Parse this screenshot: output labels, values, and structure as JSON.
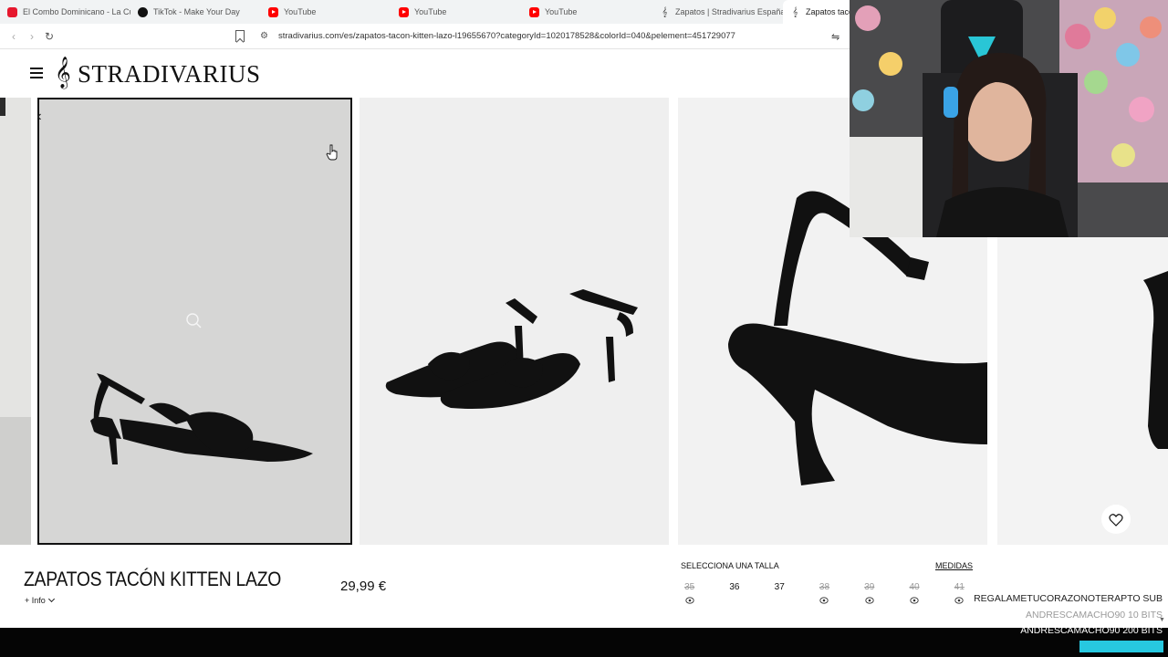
{
  "browser": {
    "tabs": [
      {
        "label": "El Combo Dominicano - La Cu",
        "favicon": "red-app-icon",
        "active": false
      },
      {
        "label": "TikTok - Make Your Day",
        "favicon": "tiktok-icon",
        "active": false
      },
      {
        "label": "YouTube",
        "favicon": "youtube-icon",
        "active": false
      },
      {
        "label": "YouTube",
        "favicon": "youtube-icon",
        "active": false
      },
      {
        "label": "YouTube",
        "favicon": "youtube-icon",
        "active": false
      },
      {
        "label": "Zapatos | Stradivarius España",
        "favicon": "stradivarius-icon",
        "active": false
      },
      {
        "label": "Zapatos tacón",
        "favicon": "stradivarius-icon",
        "active": true
      }
    ],
    "url": "stradivarius.com/es/zapatos-tacon-kitten-lazo-l19655670?categoryId=1020178528&colorId=040&pelement=451729077",
    "icons": {
      "back": "back-arrow-icon",
      "forward": "forward-arrow-icon",
      "reload": "reload-icon",
      "bookmark": "bookmark-icon",
      "site_info": "site-info-icon",
      "extension": "extension-icon"
    }
  },
  "site": {
    "logo_text": "STRADIVARIUS",
    "menu_icon": "hamburger-menu-icon"
  },
  "product": {
    "title": "ZAPATOS TACÓN KITTEN LAZO",
    "more_info": "+ Info",
    "price": "29,99 €",
    "size_label": "SELECCIONA UNA TALLA",
    "measures_link": "MEDIDAS",
    "sizes": [
      {
        "size": "35",
        "available": false
      },
      {
        "size": "36",
        "available": true
      },
      {
        "size": "37",
        "available": true
      },
      {
        "size": "38",
        "available": false
      },
      {
        "size": "39",
        "available": false
      },
      {
        "size": "40",
        "available": false
      },
      {
        "size": "41",
        "available": false
      }
    ]
  },
  "colors": {
    "ink": "#111111",
    "out_of_stock": "#9a9a9a",
    "panel_gray": "#d6d6d5",
    "stream_badge": "#27c8e0",
    "bottom_bar": "#050505"
  },
  "stream": {
    "chat": [
      "REGALAMETUCORAZONOTERAPTO  SUB",
      "ANDRESCAMACHO90  10 BITS",
      "ANDRESCAMACHO90  200 BITS"
    ]
  }
}
